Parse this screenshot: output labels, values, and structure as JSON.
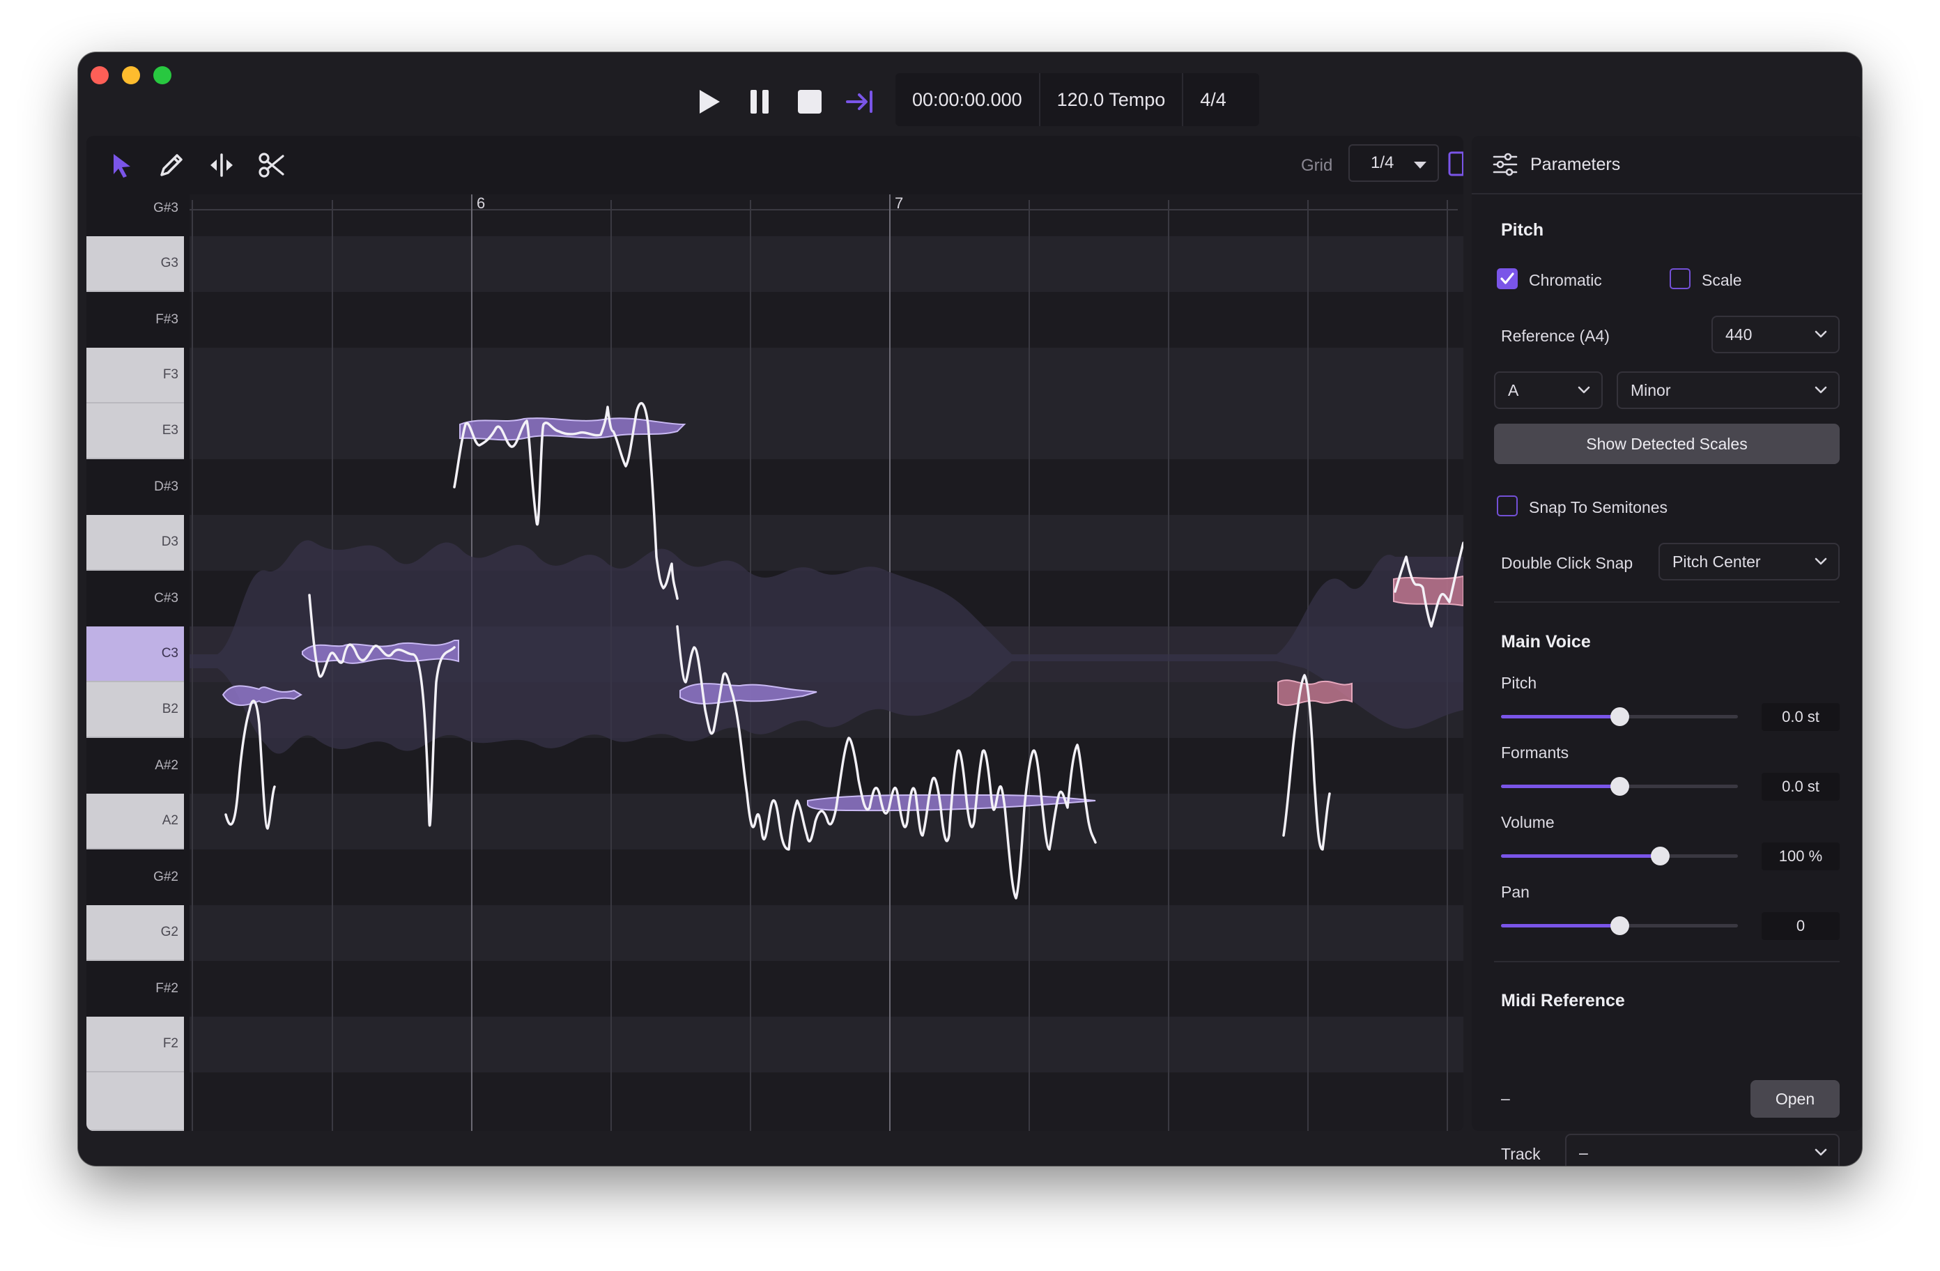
{
  "transport": {
    "time": "00:00:00.000",
    "tempo": "120.0 Tempo",
    "signature": "4/4"
  },
  "toolbar": {
    "tools": [
      "pointer-tool",
      "pencil-tool",
      "stretch-tool",
      "scissors-tool"
    ],
    "grid_label": "Grid",
    "grid_value": "1/4"
  },
  "ruler": {
    "bar_6": "6",
    "bar_7": "7"
  },
  "keys": [
    "G#3",
    "G3",
    "F#3",
    "F3",
    "E3",
    "D#3",
    "D3",
    "C#3",
    "C3",
    "B2",
    "A#2",
    "A2",
    "G#2",
    "G2",
    "F#2",
    "F2"
  ],
  "active_key": "C3",
  "panel": {
    "title": "Parameters",
    "pitch": {
      "title": "Pitch",
      "chromatic_label": "Chromatic",
      "chromatic_checked": true,
      "scale_label": "Scale",
      "scale_checked": false,
      "reference_label": "Reference (A4)",
      "reference_value": "440",
      "key_value": "A",
      "mode_value": "Minor",
      "show_scales_label": "Show Detected Scales",
      "snap_label": "Snap To Semitones",
      "snap_checked": false,
      "dbl_click_label": "Double Click Snap",
      "dbl_click_value": "Pitch Center"
    },
    "main_voice": {
      "title": "Main Voice",
      "pitch_label": "Pitch",
      "pitch_value": "0.0 st",
      "pitch_level": 0.5,
      "formants_label": "Formants",
      "formants_value": "0.0 st",
      "formants_level": 0.5,
      "volume_label": "Volume",
      "volume_value": "100 %",
      "volume_level": 0.67,
      "pan_label": "Pan",
      "pan_value": "0",
      "pan_level": 0.5
    },
    "midi": {
      "title": "Midi Reference",
      "file_value": "–",
      "open_label": "Open",
      "track_label": "Track",
      "track_value": "–"
    }
  },
  "colors": {
    "accent": "#7a55e8",
    "note_fill": "#8f76c9",
    "note_alt": "#c77b93"
  }
}
